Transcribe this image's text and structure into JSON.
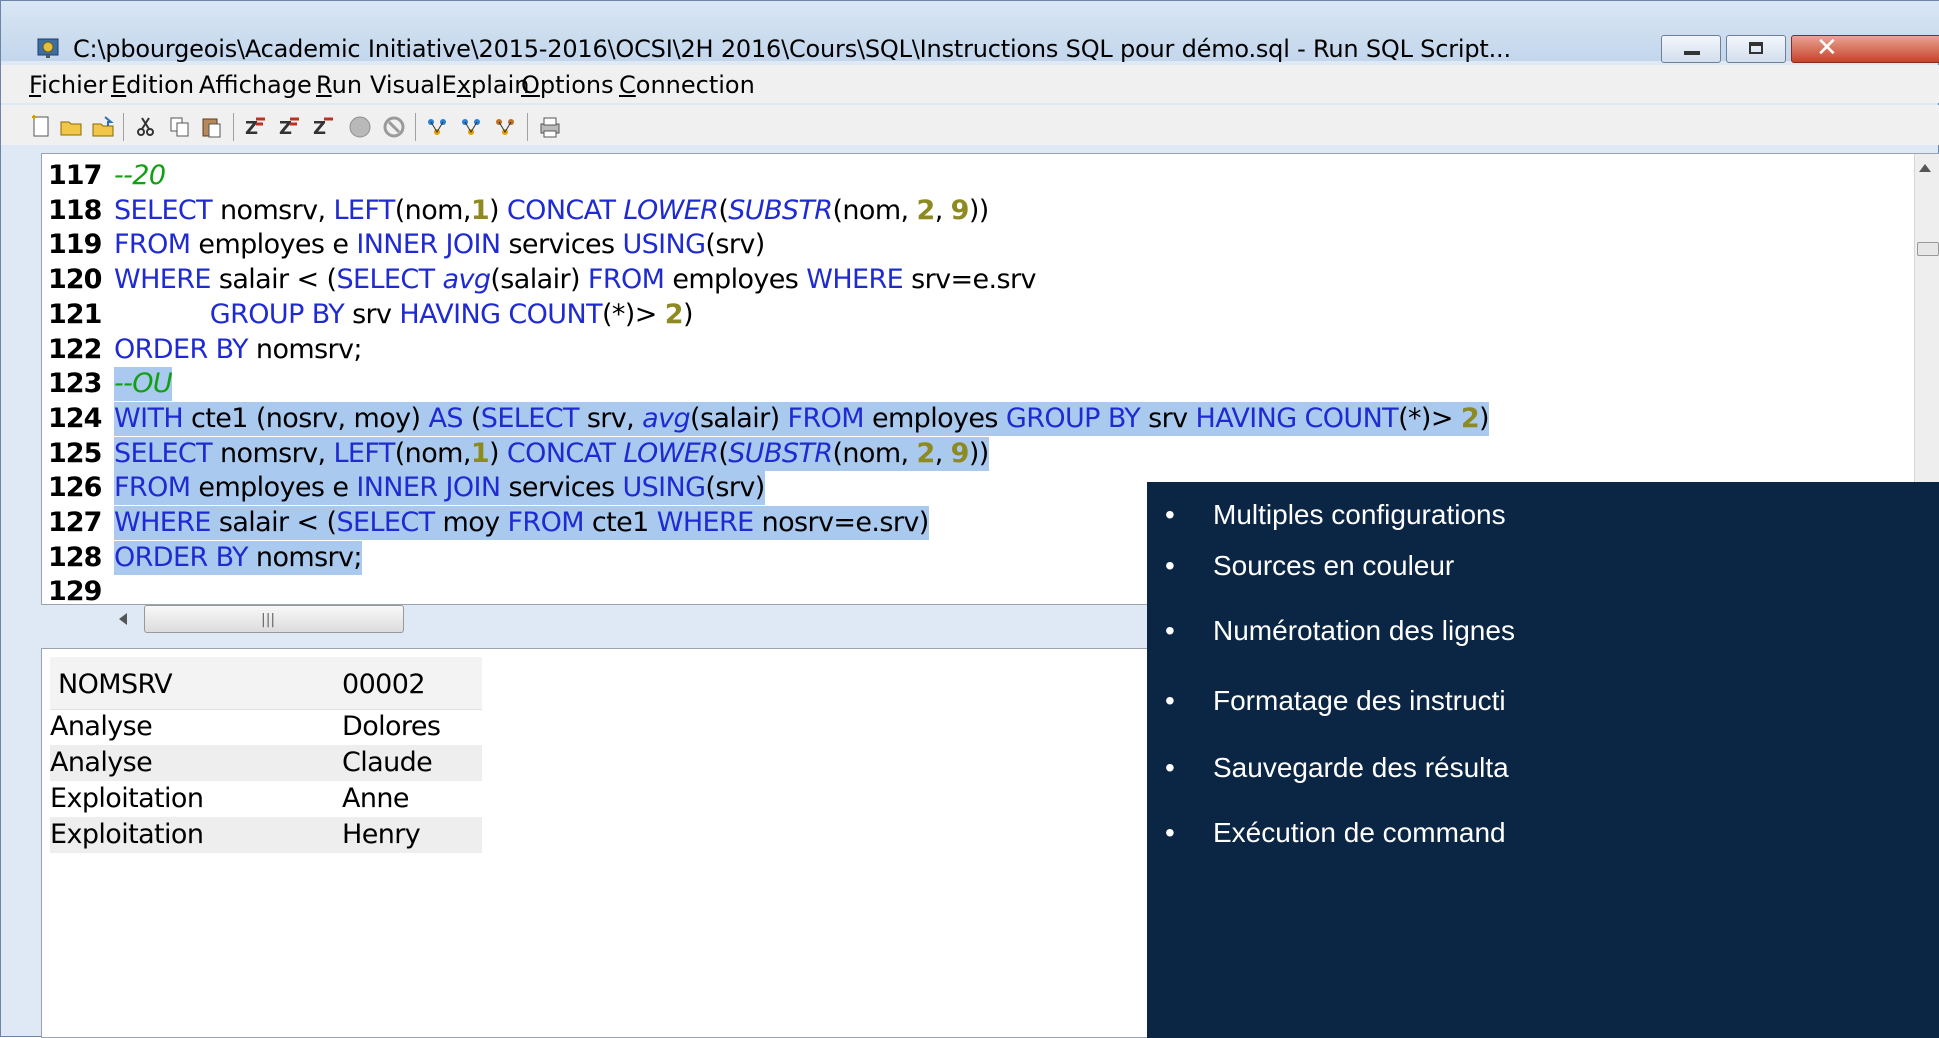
{
  "window": {
    "title": "C:\\pbourgeois\\Academic Initiative\\2015-2016\\OCSI\\2H 2016\\Cours\\SQL\\Instructions SQL pour démo.sql - Run SQL Script..."
  },
  "menubar": {
    "items": [
      {
        "label": "Fichier",
        "underline": "F"
      },
      {
        "label": "Edition",
        "underline": "E"
      },
      {
        "label": "Affichage",
        "underline": "f"
      },
      {
        "label": "Run",
        "underline": "R"
      },
      {
        "label": "VisualExplain",
        "underline": "x"
      },
      {
        "label": "Options",
        "underline": "O"
      },
      {
        "label": "Connection",
        "underline": "C"
      }
    ]
  },
  "toolbar": {
    "icons": [
      "new-script-icon",
      "open-file-icon",
      "save-file-icon",
      "cut-icon",
      "copy-icon",
      "paste-icon",
      "run-all-icon",
      "run-from-selected-icon",
      "run-selected-icon",
      "stop-icon",
      "cancel-icon",
      "explain-icon",
      "run-and-explain-icon",
      "explain-only-icon",
      "print-icon"
    ]
  },
  "editor": {
    "lines": [
      {
        "num": "117",
        "tokens": [
          {
            "t": "--20",
            "c": "cmt"
          }
        ]
      },
      {
        "num": "118",
        "tokens": [
          {
            "t": "SELECT",
            "c": "kw"
          },
          {
            "t": " nomsrv, "
          },
          {
            "t": "LEFT",
            "c": "kw"
          },
          {
            "t": "(nom,"
          },
          {
            "t": "1",
            "c": "num"
          },
          {
            "t": ") "
          },
          {
            "t": "CONCAT",
            "c": "kw"
          },
          {
            "t": " "
          },
          {
            "t": "LOWER",
            "c": "fn"
          },
          {
            "t": "("
          },
          {
            "t": "SUBSTR",
            "c": "fn"
          },
          {
            "t": "(nom, "
          },
          {
            "t": "2",
            "c": "num"
          },
          {
            "t": ", "
          },
          {
            "t": "9",
            "c": "num"
          },
          {
            "t": "))"
          }
        ]
      },
      {
        "num": "119",
        "tokens": [
          {
            "t": "FROM",
            "c": "kw"
          },
          {
            "t": " employes e "
          },
          {
            "t": "INNER JOIN",
            "c": "kw"
          },
          {
            "t": " services "
          },
          {
            "t": "USING",
            "c": "kw"
          },
          {
            "t": "(srv)"
          }
        ]
      },
      {
        "num": "120",
        "tokens": [
          {
            "t": "WHERE",
            "c": "kw"
          },
          {
            "t": " salair < ("
          },
          {
            "t": "SELECT",
            "c": "kw"
          },
          {
            "t": " "
          },
          {
            "t": "avg",
            "c": "fn"
          },
          {
            "t": "(salair) "
          },
          {
            "t": "FROM",
            "c": "kw"
          },
          {
            "t": " employes "
          },
          {
            "t": "WHERE",
            "c": "kw"
          },
          {
            "t": " srv=e.srv"
          }
        ]
      },
      {
        "num": "121",
        "tokens": [
          {
            "t": "            "
          },
          {
            "t": "GROUP BY",
            "c": "kw"
          },
          {
            "t": " srv "
          },
          {
            "t": "HAVING",
            "c": "kw"
          },
          {
            "t": " "
          },
          {
            "t": "COUNT",
            "c": "kw"
          },
          {
            "t": "(*)> "
          },
          {
            "t": "2",
            "c": "num"
          },
          {
            "t": ")"
          }
        ]
      },
      {
        "num": "122",
        "tokens": [
          {
            "t": "ORDER BY",
            "c": "kw"
          },
          {
            "t": " nomsrv;"
          }
        ]
      },
      {
        "num": "123",
        "sel": true,
        "tokens": [
          {
            "t": "--OU",
            "c": "cmt"
          }
        ]
      },
      {
        "num": "124",
        "sel": true,
        "tokens": [
          {
            "t": "WITH",
            "c": "kw"
          },
          {
            "t": " cte1 (nosrv, moy) "
          },
          {
            "t": "AS",
            "c": "kw"
          },
          {
            "t": " ("
          },
          {
            "t": "SELECT",
            "c": "kw"
          },
          {
            "t": " srv, "
          },
          {
            "t": "avg",
            "c": "fn"
          },
          {
            "t": "(salair) "
          },
          {
            "t": "FROM",
            "c": "kw"
          },
          {
            "t": " employes "
          },
          {
            "t": "GROUP BY",
            "c": "kw"
          },
          {
            "t": " srv "
          },
          {
            "t": "HAVING",
            "c": "kw"
          },
          {
            "t": " "
          },
          {
            "t": "COUNT",
            "c": "kw"
          },
          {
            "t": "(*)> "
          },
          {
            "t": "2",
            "c": "num"
          },
          {
            "t": ")"
          }
        ]
      },
      {
        "num": "125",
        "sel": true,
        "tokens": [
          {
            "t": "SELECT",
            "c": "kw"
          },
          {
            "t": " nomsrv, "
          },
          {
            "t": "LEFT",
            "c": "kw"
          },
          {
            "t": "(nom,"
          },
          {
            "t": "1",
            "c": "num"
          },
          {
            "t": ") "
          },
          {
            "t": "CONCAT",
            "c": "kw"
          },
          {
            "t": " "
          },
          {
            "t": "LOWER",
            "c": "fn"
          },
          {
            "t": "("
          },
          {
            "t": "SUBSTR",
            "c": "fn"
          },
          {
            "t": "(nom, "
          },
          {
            "t": "2",
            "c": "num"
          },
          {
            "t": ", "
          },
          {
            "t": "9",
            "c": "num"
          },
          {
            "t": "))"
          }
        ]
      },
      {
        "num": "126",
        "sel": true,
        "tokens": [
          {
            "t": "FROM",
            "c": "kw"
          },
          {
            "t": " employes e "
          },
          {
            "t": "INNER JOIN",
            "c": "kw"
          },
          {
            "t": " services "
          },
          {
            "t": "USING",
            "c": "kw"
          },
          {
            "t": "(srv)"
          }
        ]
      },
      {
        "num": "127",
        "sel": true,
        "tokens": [
          {
            "t": "WHERE",
            "c": "kw"
          },
          {
            "t": " salair < ("
          },
          {
            "t": "SELECT",
            "c": "kw"
          },
          {
            "t": " moy "
          },
          {
            "t": "FROM",
            "c": "kw"
          },
          {
            "t": " cte1 "
          },
          {
            "t": "WHERE",
            "c": "kw"
          },
          {
            "t": " nosrv=e.srv)"
          }
        ]
      },
      {
        "num": "128",
        "sel": true,
        "tokens": [
          {
            "t": "ORDER BY",
            "c": "kw"
          },
          {
            "t": " nomsrv"
          },
          {
            "t": ";"
          }
        ]
      },
      {
        "num": "129",
        "tokens": []
      }
    ]
  },
  "results": {
    "columns": [
      "NOMSRV",
      "00002"
    ],
    "rows": [
      [
        "Analyse",
        "Dolores"
      ],
      [
        "Analyse",
        "Claude"
      ],
      [
        "Exploitation",
        "Anne"
      ],
      [
        "Exploitation",
        "Henry"
      ]
    ]
  },
  "panel": {
    "bullets": [
      "Multiples configurations",
      "Sources en couleur",
      "Numérotation des lignes",
      "Formatage des instructi",
      "Sauvegarde des résulta",
      "Exécution de command"
    ]
  },
  "colors": {
    "keyword": "#1f2bd1",
    "comment": "#12a012",
    "number": "#8d8a21",
    "selection": "#a9c9ef",
    "panel_bg": "#0b2545"
  }
}
